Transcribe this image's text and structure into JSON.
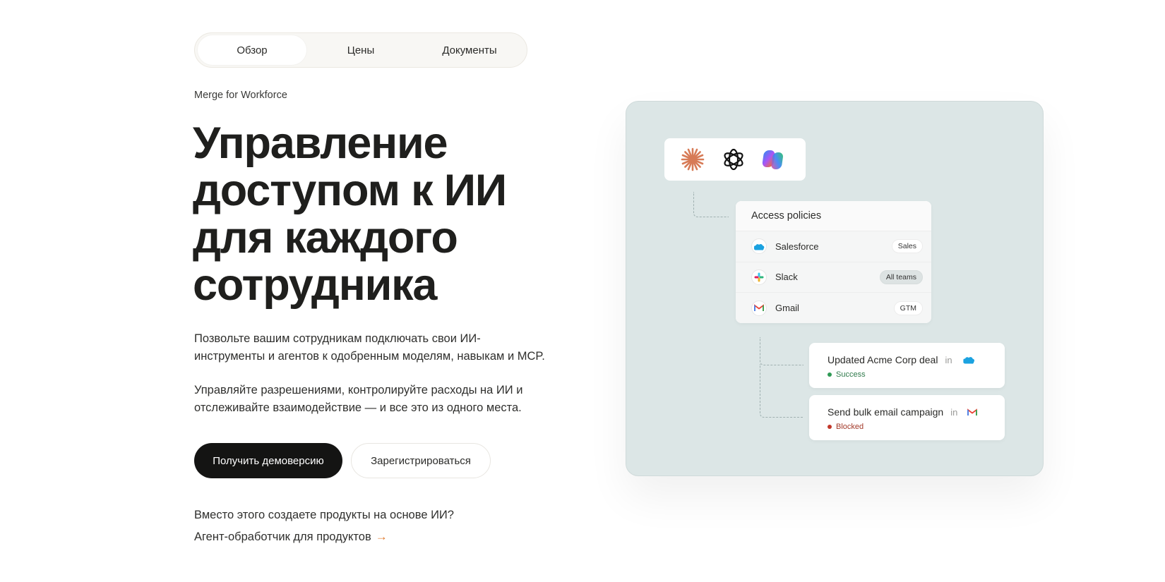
{
  "tabs": [
    {
      "label": "Обзор",
      "active": true
    },
    {
      "label": "Цены",
      "active": false
    },
    {
      "label": "Документы",
      "active": false
    }
  ],
  "hero": {
    "eyebrow": "Merge for Workforce",
    "title_lines": [
      "Управление",
      "доступом к ИИ",
      "для каждого",
      "сотрудника"
    ],
    "paragraph1": [
      "Позвольте вашим сотрудникам подключать свои ИИ-",
      "инструменты и агентов к одобренным моделям, навыкам и MCP."
    ],
    "paragraph2": [
      "Управляйте разрешениями, контролируйте расходы на ИИ и",
      "отслеживайте взаимодействие — и все это из одного места."
    ],
    "cta_primary": "Получить демоверсию",
    "cta_secondary": "Зарегистрироваться",
    "alt_question": "Вместо этого создаете продукты на основе ИИ?",
    "alt_link": "Агент-обработчик для продуктов",
    "alt_arrow": "→"
  },
  "visual": {
    "ai_icons": [
      "claude-icon",
      "openai-icon",
      "copilot-icon"
    ],
    "policies": {
      "title": "Access policies",
      "rows": [
        {
          "icon": "salesforce-icon",
          "name": "Salesforce",
          "tag": "Sales"
        },
        {
          "icon": "slack-icon",
          "name": "Slack",
          "tag": "All teams"
        },
        {
          "icon": "gmail-icon",
          "name": "Gmail",
          "tag": "GTM"
        }
      ]
    },
    "activities": [
      {
        "action": "Updated Acme Corp deal",
        "in": "in",
        "icon": "salesforce-icon",
        "status": "Success"
      },
      {
        "action": "Send bulk email campaign",
        "in": "in",
        "icon": "gmail-icon",
        "status": "Blocked"
      }
    ]
  },
  "colors": {
    "primary_button": "#141413",
    "visual_bg": "#dce6e6",
    "accent_arrow": "#e07a2d",
    "success": "#2f9a55",
    "blocked": "#c2382a"
  }
}
